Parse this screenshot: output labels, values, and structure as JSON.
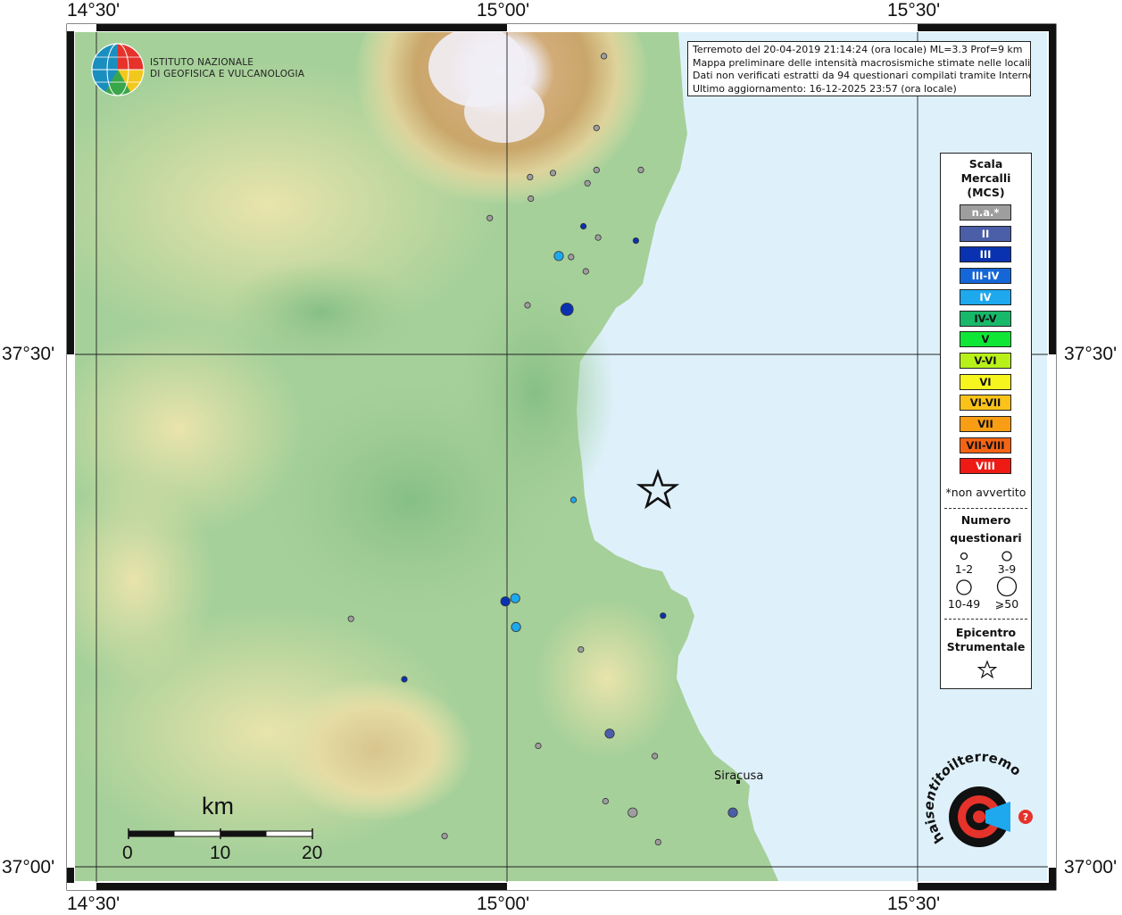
{
  "axes": {
    "top": [
      "14°30'",
      "15°00'",
      "15°30'"
    ],
    "bottom": [
      "14°30'",
      "15°00'",
      "15°30'"
    ],
    "left": [
      "37°30'",
      "37°00'"
    ],
    "right": [
      "37°30'",
      "37°00'"
    ]
  },
  "institute": {
    "line1": "ISTITUTO NAZIONALE",
    "line2": "DI GEOFISICA E VULCANOLOGIA"
  },
  "info": {
    "line1": "Terremoto del 20-04-2019 21:14:24 (ora locale) ML=3.3 Prof=9 km",
    "line2": "Mappa preliminare delle intensità macrosismiche stimate nelle località",
    "line3": "Dati non verificati estratti da 94 questionari compilati tramite Internet.",
    "line4": "Ultimo aggiornamento: 16-12-2025 23:57 (ora locale)"
  },
  "legend": {
    "title1": "Scala",
    "title2": "Mercalli",
    "title3": "(MCS)",
    "classes": [
      {
        "label": "n.a.*",
        "color": "#9e9e9e",
        "text": "#ffffff"
      },
      {
        "label": "II",
        "color": "#4b5ea8",
        "text": "#ffffff"
      },
      {
        "label": "III",
        "color": "#0a32b0",
        "text": "#ffffff"
      },
      {
        "label": "III-IV",
        "color": "#1567d8",
        "text": "#ffffff"
      },
      {
        "label": "IV",
        "color": "#1ea8ee",
        "text": "#ffffff"
      },
      {
        "label": "IV-V",
        "color": "#18b86a",
        "text": "#111111"
      },
      {
        "label": "V",
        "color": "#10e636",
        "text": "#111111"
      },
      {
        "label": "V-VI",
        "color": "#b8f01a",
        "text": "#111111"
      },
      {
        "label": "VI",
        "color": "#f7f51e",
        "text": "#111111"
      },
      {
        "label": "VI-VII",
        "color": "#fbc21a",
        "text": "#111111"
      },
      {
        "label": "VII",
        "color": "#f99d14",
        "text": "#111111"
      },
      {
        "label": "VII-VIII",
        "color": "#f56414",
        "text": "#111111"
      },
      {
        "label": "VIII",
        "color": "#ee1a14",
        "text": "#ffffff"
      }
    ],
    "note": "*non avvertito",
    "count_title1": "Numero",
    "count_title2": "questionari",
    "counts": [
      "1-2",
      "3-9",
      "10-49",
      "⩾50"
    ],
    "epi_title1": "Epicentro",
    "epi_title2": "Strumentale"
  },
  "scale": {
    "unit": "km",
    "ticks": [
      "0",
      "10",
      "20"
    ]
  },
  "city": "Siracusa",
  "points": [
    {
      "lon": 15.118,
      "lat": 37.791,
      "i": "n.a.",
      "n": "1-2"
    },
    {
      "lon": 15.109,
      "lat": 37.721,
      "i": "n.a.",
      "n": "1-2"
    },
    {
      "lon": 15.109,
      "lat": 37.68,
      "i": "n.a.",
      "n": "1-2"
    },
    {
      "lon": 15.163,
      "lat": 37.68,
      "i": "n.a.",
      "n": "1-2"
    },
    {
      "lon": 15.056,
      "lat": 37.677,
      "i": "n.a.",
      "n": "1-2"
    },
    {
      "lon": 15.028,
      "lat": 37.673,
      "i": "n.a.",
      "n": "1-2"
    },
    {
      "lon": 15.098,
      "lat": 37.667,
      "i": "n.a.",
      "n": "1-2"
    },
    {
      "lon": 15.029,
      "lat": 37.652,
      "i": "n.a.",
      "n": "1-2"
    },
    {
      "lon": 14.979,
      "lat": 37.633,
      "i": "n.a.",
      "n": "1-2"
    },
    {
      "lon": 15.093,
      "lat": 37.625,
      "i": "III",
      "n": "1-2"
    },
    {
      "lon": 15.111,
      "lat": 37.614,
      "i": "n.a.",
      "n": "1-2"
    },
    {
      "lon": 15.157,
      "lat": 37.611,
      "i": "III",
      "n": "1-2"
    },
    {
      "lon": 15.063,
      "lat": 37.596,
      "i": "IV",
      "n": "3-9"
    },
    {
      "lon": 15.078,
      "lat": 37.595,
      "i": "n.a.",
      "n": "1-2"
    },
    {
      "lon": 15.096,
      "lat": 37.581,
      "i": "n.a.",
      "n": "1-2"
    },
    {
      "lon": 15.025,
      "lat": 37.548,
      "i": "n.a.",
      "n": "1-2"
    },
    {
      "lon": 15.073,
      "lat": 37.544,
      "i": "III",
      "n": "10-49"
    },
    {
      "lon": 15.081,
      "lat": 37.358,
      "i": "IV",
      "n": "1-2"
    },
    {
      "lon": 15.01,
      "lat": 37.262,
      "i": "IV",
      "n": "3-9"
    },
    {
      "lon": 14.998,
      "lat": 37.259,
      "i": "III",
      "n": "3-9"
    },
    {
      "lon": 15.19,
      "lat": 37.245,
      "i": "III",
      "n": "1-2"
    },
    {
      "lon": 14.81,
      "lat": 37.242,
      "i": "n.a.",
      "n": "1-2"
    },
    {
      "lon": 15.011,
      "lat": 37.234,
      "i": "IV",
      "n": "3-9"
    },
    {
      "lon": 15.09,
      "lat": 37.212,
      "i": "n.a.",
      "n": "1-2"
    },
    {
      "lon": 14.875,
      "lat": 37.183,
      "i": "III",
      "n": "1-2"
    },
    {
      "lon": 15.125,
      "lat": 37.13,
      "i": "II",
      "n": "3-9"
    },
    {
      "lon": 15.038,
      "lat": 37.118,
      "i": "n.a.",
      "n": "1-2"
    },
    {
      "lon": 15.18,
      "lat": 37.108,
      "i": "n.a.",
      "n": "1-2"
    },
    {
      "lon": 15.12,
      "lat": 37.064,
      "i": "n.a.",
      "n": "1-2"
    },
    {
      "lon": 15.153,
      "lat": 37.053,
      "i": "n.a.",
      "n": "3-9"
    },
    {
      "lon": 15.275,
      "lat": 37.053,
      "i": "II",
      "n": "3-9"
    },
    {
      "lon": 14.924,
      "lat": 37.03,
      "i": "n.a.",
      "n": "1-2"
    },
    {
      "lon": 15.184,
      "lat": 37.024,
      "i": "n.a.",
      "n": "1-2"
    }
  ],
  "epicenter": {
    "lon": 15.185,
    "lat": 37.375
  }
}
